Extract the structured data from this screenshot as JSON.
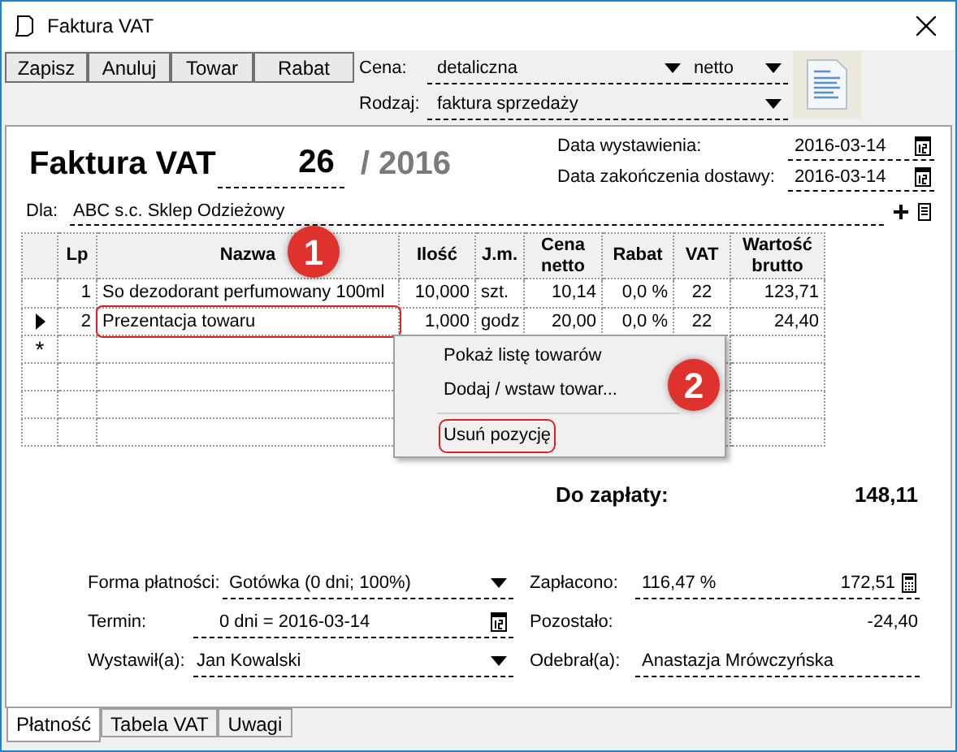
{
  "window": {
    "title": "Faktura VAT"
  },
  "toolbar": {
    "buttons": [
      "Zapisz",
      "Anuluj",
      "Towar",
      "Rabat"
    ],
    "price_label": "Cena:",
    "price": "detaliczna",
    "price_mode": "netto",
    "kind_label": "Rodzaj:",
    "kind": "faktura sprzedaży"
  },
  "header": {
    "title": "Faktura VAT",
    "number": "26",
    "year": "/ 2016",
    "issue_date_label": "Data wystawienia:",
    "issue_date": "2016-03-14",
    "delivery_date_label": "Data zakończenia dostawy:",
    "delivery_date": "2016-03-14",
    "buyer_label": "Dla:",
    "buyer": "ABC s.c. Sklep Odzieżowy"
  },
  "table": {
    "columns": [
      "Lp",
      "Nazwa",
      "Ilość",
      "J.m.",
      "Cena netto",
      "Rabat",
      "VAT",
      "Wartość brutto"
    ],
    "rows": [
      {
        "selected": false,
        "cells": [
          "1",
          "So dezodorant perfumowany 100ml",
          "10,000",
          "szt.",
          "10,14",
          "0,0 %",
          "22",
          "123,71"
        ]
      },
      {
        "selected": true,
        "cells": [
          "2",
          "Prezentacja towaru",
          "1,000",
          "godz",
          "20,00",
          "0,0 %",
          "22",
          "24,40"
        ]
      }
    ],
    "new_row_marker": "*"
  },
  "context_menu": {
    "items": [
      {
        "label": "Pokaż listę towarów",
        "highlighted": false
      },
      {
        "label": "Dodaj / wstaw towar...",
        "highlighted": false
      },
      {
        "label": "Usuń pozycję",
        "highlighted": true
      }
    ]
  },
  "callouts": [
    "1",
    "2"
  ],
  "total": {
    "label": "Do zapłaty:",
    "value": "148,11"
  },
  "payment": {
    "method_label": "Forma płatności:",
    "method": "Gotówka (0 dni; 100%)",
    "due_label": "Termin:",
    "due": "0 dni = 2016-03-14",
    "issuer_label": "Wystawił(a):",
    "issuer": "Jan Kowalski",
    "paid_label": "Zapłacono:",
    "paid_percent": "116,47 %",
    "paid": "172,51",
    "remaining_label": "Pozostało:",
    "remaining": "-24,40",
    "receiver_label": "Odebrał(a):",
    "receiver": "Anastazja Mrówczyńska"
  },
  "tabs": [
    {
      "label": "Płatność",
      "selected": true
    },
    {
      "label": "Tabela VAT",
      "selected": false
    },
    {
      "label": "Uwagi",
      "selected": false
    }
  ]
}
